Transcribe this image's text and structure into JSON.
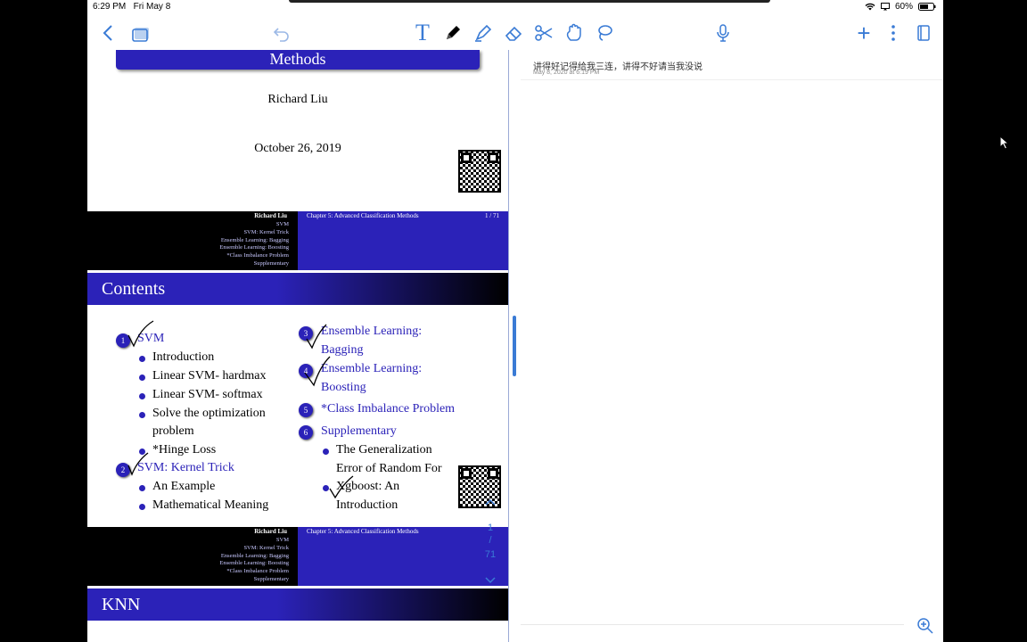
{
  "status": {
    "time": "6:29 PM",
    "date": "Fri May 8",
    "battery": "60%"
  },
  "toolbar": {
    "back": "back-icon",
    "pages": "pages-icon",
    "undo": "undo-icon",
    "text_tool": "T",
    "tools": [
      "pen-icon",
      "highlighter-icon",
      "eraser-icon",
      "scissors-icon",
      "hand-icon",
      "lasso-icon"
    ],
    "mic": "mic-icon",
    "add": "+",
    "more": "more-icon",
    "export": "export-icon"
  },
  "slide1": {
    "title": "Methods",
    "author": "Richard Liu",
    "date": "October 26, 2019"
  },
  "header": {
    "author": "Richard Liu",
    "chapter": "Chapter 5: Advanced Classification Methods",
    "page": "1 / 71"
  },
  "nav_items": [
    "SVM",
    "SVM: Kernel Trick",
    "Ensemble Learning: Bagging",
    "Ensemble Learning: Boosting",
    "*Class Imbalance Problem",
    "Supplementary"
  ],
  "contents": {
    "title": "Contents",
    "s1": {
      "num": "1",
      "label": "SVM",
      "subs": [
        "Introduction",
        "Linear SVM- hardmax",
        "Linear SVM- softmax",
        "Solve the optimization",
        "problem",
        "*Hinge Loss"
      ]
    },
    "s2": {
      "num": "2",
      "label": "SVM: Kernel Trick",
      "subs": [
        "An Example",
        "Mathematical Meaning"
      ]
    },
    "s3": {
      "num": "3",
      "label1": "Ensemble Learning:",
      "label2": "Bagging"
    },
    "s4": {
      "num": "4",
      "label1": "Ensemble Learning:",
      "label2": "Boosting"
    },
    "s5": {
      "num": "5",
      "label": "*Class Imbalance Problem"
    },
    "s6": {
      "num": "6",
      "label": "Supplementary",
      "subs": [
        "The Generalization",
        "Error of Random For",
        "Xgboost: An",
        "Introduction"
      ]
    }
  },
  "slide3": {
    "title": "KNN"
  },
  "page_control": {
    "current": "1",
    "sep": "/",
    "total": "71"
  },
  "note": {
    "text": "讲得好记得给我三连，讲得不好请当我没说",
    "timestamp": "May 8, 2020 at 6:19 PM"
  }
}
